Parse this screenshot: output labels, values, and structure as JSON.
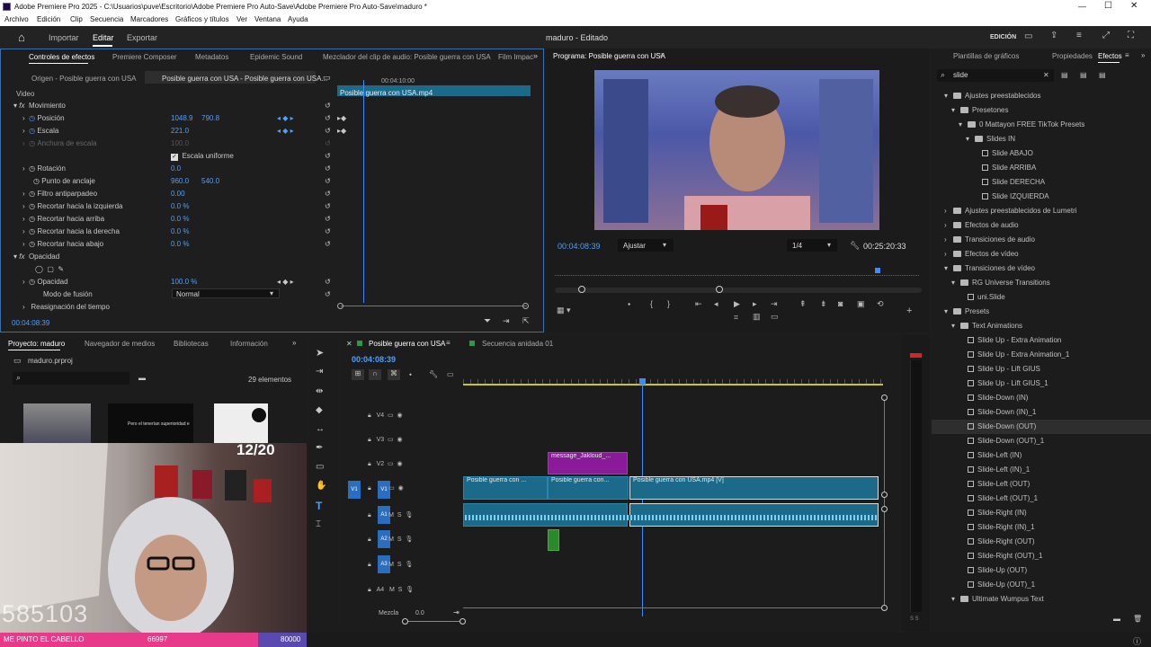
{
  "window": {
    "title": "Adobe Premiere Pro 2025 - C:\\Usuarios\\puve\\Escritorio\\Adobe Premiere Pro Auto-Save\\Adobe Premiere Pro Auto-Save\\maduro *"
  },
  "menu": [
    "Archivo",
    "Edición",
    "Clip",
    "Secuencia",
    "Marcadores",
    "Gráficos y títulos",
    "Ver",
    "Ventana",
    "Ayuda"
  ],
  "appbar": {
    "tabs": [
      "Importar",
      "Editar",
      "Exportar"
    ],
    "project": "maduro - Editado",
    "workspace": "EDICIÓN"
  },
  "effect_controls": {
    "tabs": [
      "Controles de efectos",
      "Premiere Composer",
      "Metadatos",
      "Epidemic Sound",
      "Mezclador del clip de audio: Posible guerra con USA",
      "Film Impac"
    ],
    "source": "Origen - Posible guerra con USA",
    "target": "Posible guerra con USA - Posible guerra con USA...",
    "ruler_time": "00:04:10:00",
    "clip_name": "Posible guerra con USA.mp4",
    "section_video": "Video",
    "motion": "Movimiento",
    "posicion": {
      "label": "Posición",
      "x": "1048.9",
      "y": "790.8"
    },
    "escala": {
      "label": "Escala",
      "v": "221.0"
    },
    "anchura": {
      "label": "Anchura de escala",
      "v": "100.0"
    },
    "uniforme": "Escala uniforme",
    "rotacion": {
      "label": "Rotación",
      "v": "0.0"
    },
    "anclaje": {
      "label": "Punto de anclaje",
      "x": "960.0",
      "y": "540.0"
    },
    "filtro": {
      "label": "Filtro antiparpadeo",
      "v": "0.00"
    },
    "crop_left": {
      "label": "Recortar hacia la izquierda",
      "v": "0.0 %"
    },
    "crop_top": {
      "label": "Recortar hacia arriba",
      "v": "0.0 %"
    },
    "crop_right": {
      "label": "Recortar hacia la derecha",
      "v": "0.0 %"
    },
    "crop_bottom": {
      "label": "Recortar hacia abajo",
      "v": "0.0 %"
    },
    "opacidad_section": "Opacidad",
    "opacidad": {
      "label": "Opacidad",
      "v": "100.0 %"
    },
    "fusion": {
      "label": "Modo de fusión",
      "v": "Normal"
    },
    "remap": "Reasignación del tiempo",
    "timecode": "00:04:08:39"
  },
  "program": {
    "title": "Programa: Posible guerra con USA",
    "timecode": "00:04:08:39",
    "fit": "Ajustar",
    "quality": "1/4",
    "duration": "00:25:20:33"
  },
  "effects": {
    "tabs": [
      "Plantillas de gráficos",
      "Propiedades",
      "Efectos"
    ],
    "search": "slide",
    "tree": [
      {
        "lvl": 0,
        "t": "Ajustes preestablecidos",
        "k": "folder",
        "open": true
      },
      {
        "lvl": 1,
        "t": "Presetones",
        "k": "folder",
        "open": true
      },
      {
        "lvl": 2,
        "t": "0 Mattayon FREE TikTok Presets",
        "k": "folder",
        "open": true
      },
      {
        "lvl": 3,
        "t": "Slides IN",
        "k": "folder",
        "open": true
      },
      {
        "lvl": 4,
        "t": "Slide ABAJO",
        "k": "fx"
      },
      {
        "lvl": 4,
        "t": "Slide ARRIBA",
        "k": "fx"
      },
      {
        "lvl": 4,
        "t": "Slide DERECHA",
        "k": "fx"
      },
      {
        "lvl": 4,
        "t": "Slide IZQUIERDA",
        "k": "fx"
      },
      {
        "lvl": 0,
        "t": "Ajustes preestablecidos de Lumetri",
        "k": "folder"
      },
      {
        "lvl": 0,
        "t": "Efectos de audio",
        "k": "folder"
      },
      {
        "lvl": 0,
        "t": "Transiciones de audio",
        "k": "folder"
      },
      {
        "lvl": 0,
        "t": "Efectos de vídeo",
        "k": "folder"
      },
      {
        "lvl": 0,
        "t": "Transiciones de vídeo",
        "k": "folder",
        "open": true
      },
      {
        "lvl": 1,
        "t": "RG Universe Transitions",
        "k": "folder",
        "open": true
      },
      {
        "lvl": 2,
        "t": "uni.Slide",
        "k": "fx"
      },
      {
        "lvl": 0,
        "t": "Presets",
        "k": "folder",
        "open": true
      },
      {
        "lvl": 1,
        "t": "Text Animations",
        "k": "folder",
        "open": true
      },
      {
        "lvl": 2,
        "t": "Slide Up - Extra Animation",
        "k": "fx"
      },
      {
        "lvl": 2,
        "t": "Slide Up - Extra Animation_1",
        "k": "fx"
      },
      {
        "lvl": 2,
        "t": "Slide Up - Lift GIUS",
        "k": "fx"
      },
      {
        "lvl": 2,
        "t": "Slide Up - Lift GIUS_1",
        "k": "fx"
      },
      {
        "lvl": 2,
        "t": "Slide-Down (IN)",
        "k": "fx"
      },
      {
        "lvl": 2,
        "t": "Slide-Down (IN)_1",
        "k": "fx"
      },
      {
        "lvl": 2,
        "t": "Slide-Down (OUT)",
        "k": "fx",
        "sel": true
      },
      {
        "lvl": 2,
        "t": "Slide-Down (OUT)_1",
        "k": "fx"
      },
      {
        "lvl": 2,
        "t": "Slide-Left (IN)",
        "k": "fx"
      },
      {
        "lvl": 2,
        "t": "Slide-Left (IN)_1",
        "k": "fx"
      },
      {
        "lvl": 2,
        "t": "Slide-Left (OUT)",
        "k": "fx"
      },
      {
        "lvl": 2,
        "t": "Slide-Left (OUT)_1",
        "k": "fx"
      },
      {
        "lvl": 2,
        "t": "Slide-Right (IN)",
        "k": "fx"
      },
      {
        "lvl": 2,
        "t": "Slide-Right (IN)_1",
        "k": "fx"
      },
      {
        "lvl": 2,
        "t": "Slide-Right (OUT)",
        "k": "fx"
      },
      {
        "lvl": 2,
        "t": "Slide-Right (OUT)_1",
        "k": "fx"
      },
      {
        "lvl": 2,
        "t": "Slide-Up (OUT)",
        "k": "fx"
      },
      {
        "lvl": 2,
        "t": "Slide-Up (OUT)_1",
        "k": "fx"
      },
      {
        "lvl": 1,
        "t": "Ultimate Wumpus Text",
        "k": "folder",
        "open": true
      }
    ]
  },
  "project": {
    "tabs": [
      "Proyecto: maduro",
      "Navegador de medios",
      "Bibliotecas",
      "Información"
    ],
    "file": "maduro.prproj",
    "count": "29 elementos",
    "thumb_text": "Pero el tenerían superioridad e"
  },
  "timeline": {
    "tabs": [
      "Posible guerra con USA",
      "Secuencia anidada 01"
    ],
    "timecode": "00:04:08:39",
    "tracks_v": [
      "V4",
      "V3",
      "V2",
      "V1"
    ],
    "tracks_a": [
      "A1",
      "A2",
      "A3",
      "A4"
    ],
    "src_v": "V1",
    "mix": "Mezcla",
    "mix_val": "0.0",
    "clips": {
      "c1": "Posible guerra con ...",
      "c2": "Posible guerra con...",
      "c3": "Posible guerra con USA.mp4 [V]",
      "c4": "message_Jakloud_..."
    }
  },
  "overlay": {
    "counter": "12/20",
    "big_num": "585103",
    "banner_text": "ME PINTO EL CABELLO",
    "banner_val": "66997",
    "banner_goal": "80000"
  }
}
